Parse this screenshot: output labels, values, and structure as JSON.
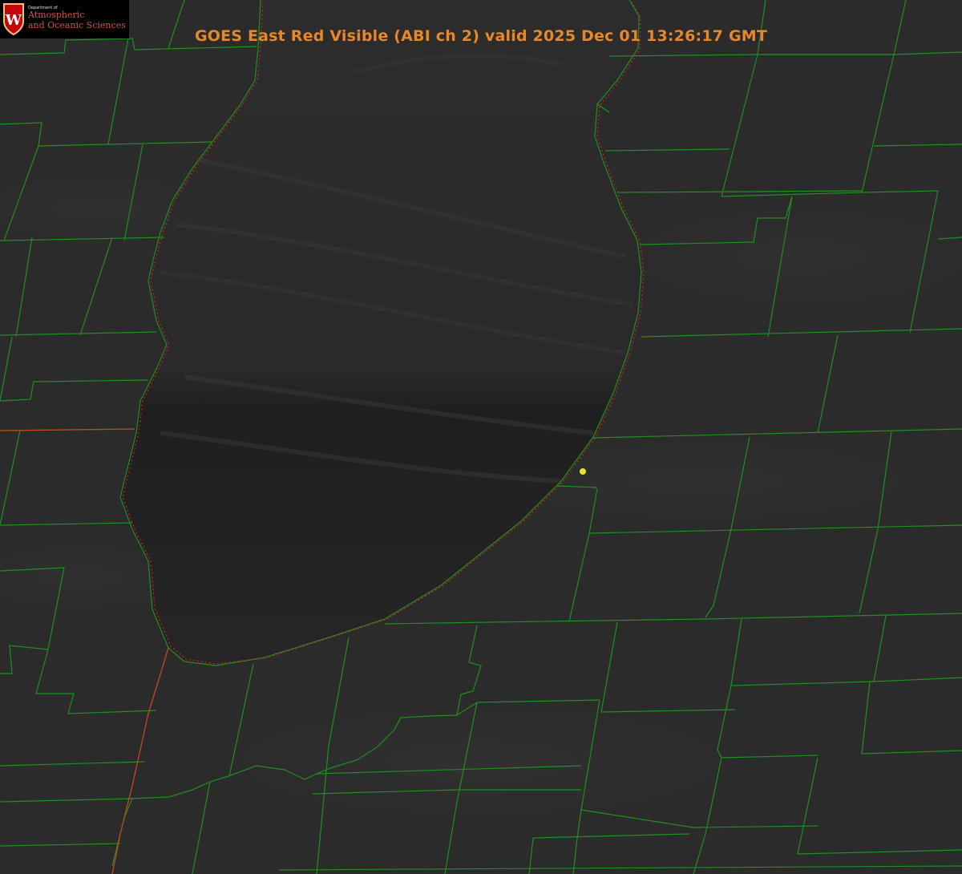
{
  "title": "GOES East Red Visible (ABI ch 2) valid 2025 Dec 01 13:26:17 GMT",
  "logo": {
    "department": "Department of",
    "line1": "Atmospheric",
    "line2": "and Oceanic Sciences",
    "crest_letter": "W"
  },
  "colors": {
    "background": "#2b2b2b",
    "lake": "#262626",
    "county_lines": "#1f8f1f",
    "shoreline_dotted": "#d42020",
    "state_line": "#b84a1e",
    "title": "#e8862a",
    "marker": "#e5e52e"
  },
  "map": {
    "product": "visible satellite imagery",
    "features": [
      "lake",
      "county-boundaries",
      "state-boundaries",
      "location-marker"
    ]
  }
}
